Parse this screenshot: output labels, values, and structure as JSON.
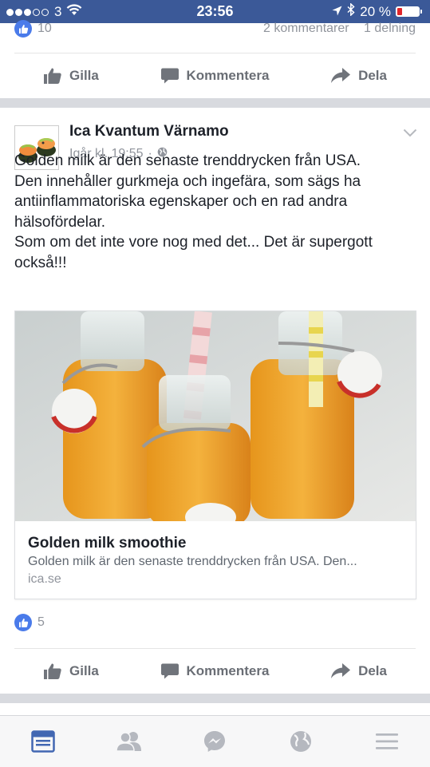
{
  "status_bar": {
    "carrier": "3",
    "time": "23:56",
    "battery_text": "20 %",
    "battery_level": 0.2,
    "signal_dots_filled": 3,
    "signal_dots_total": 5
  },
  "previous_post": {
    "likes": "10",
    "comments": "2 kommentarer",
    "shares": "1 delning"
  },
  "actions": {
    "like": "Gilla",
    "comment": "Kommentera",
    "share": "Dela"
  },
  "post": {
    "page_name": "Ica Kvantum Värnamo",
    "time": "Igår kl. 19:55",
    "separator": "·",
    "privacy_icon": "globe-icon",
    "text_lines": [
      "Golden milk är den senaste trenddrycken från USA.",
      "Den innehåller gurkmeja och ingefära, som sägs ha antiinflammatoriska egenskaper och en rad andra hälsofördelar.",
      "Som om det inte vore nog med det... Det är supergott också!!!"
    ],
    "link": {
      "title": "Golden milk smoothie",
      "description": "Golden milk är den senaste trenddrycken från USA. Den...",
      "domain": "ica.se"
    },
    "likes": "5"
  },
  "bottom_nav": [
    {
      "name": "news-feed-icon",
      "active": true
    },
    {
      "name": "friends-icon",
      "active": false
    },
    {
      "name": "messenger-icon",
      "active": false
    },
    {
      "name": "globe-notifications-icon",
      "active": false
    },
    {
      "name": "menu-icon",
      "active": false
    }
  ],
  "colors": {
    "facebook_blue": "#3b5998",
    "like_blue": "#4a7bea",
    "active_nav": "#4267b2",
    "inactive_nav": "#b5b8bf",
    "battery_low": "#e0262a"
  }
}
